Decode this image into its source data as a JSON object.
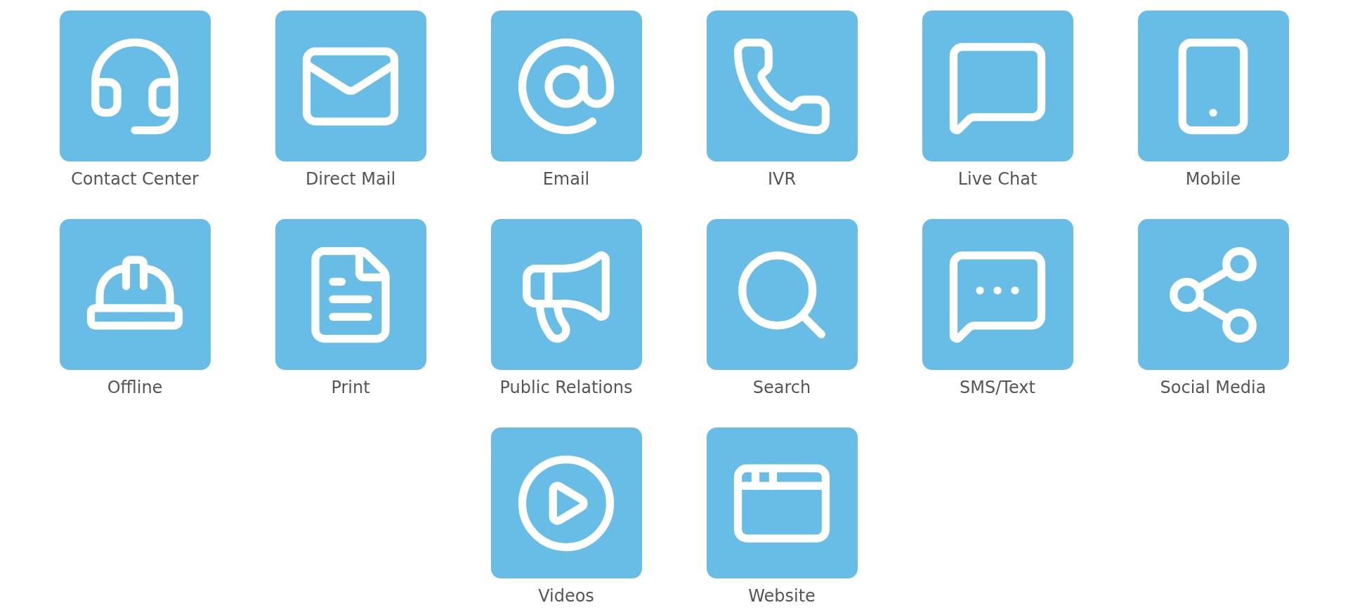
{
  "rows": [
    {
      "tiles": [
        {
          "label": "Contact Center",
          "kind": "headset"
        },
        {
          "label": "Direct Mail",
          "kind": "mail"
        },
        {
          "label": "Email",
          "kind": "at"
        },
        {
          "label": "IVR",
          "kind": "phone"
        },
        {
          "label": "Live Chat",
          "kind": "chat"
        },
        {
          "label": "Mobile",
          "kind": "mobile"
        }
      ]
    },
    {
      "tiles": [
        {
          "label": "Offline",
          "kind": "worker"
        },
        {
          "label": "Print",
          "kind": "document"
        },
        {
          "label": "Public Relations",
          "kind": "megaphone"
        },
        {
          "label": "Search",
          "kind": "search"
        },
        {
          "label": "SMS/Text",
          "kind": "sms"
        },
        {
          "label": "Social Media",
          "kind": "share"
        }
      ]
    },
    {
      "tiles": [
        {
          "label": "Videos",
          "kind": "play"
        },
        {
          "label": "Website",
          "kind": "browser"
        }
      ]
    }
  ]
}
